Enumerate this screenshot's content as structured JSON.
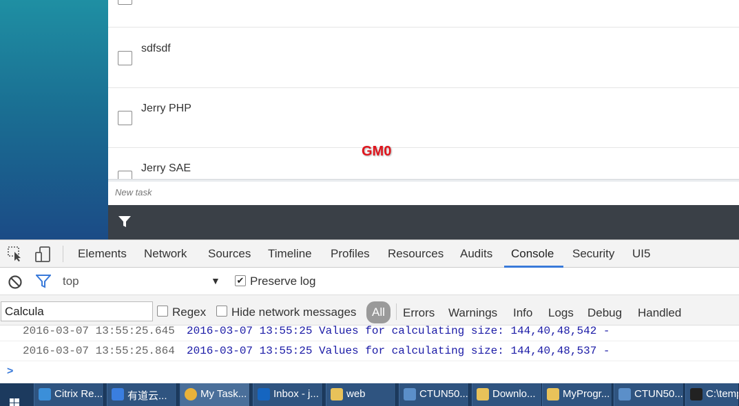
{
  "app": {
    "tasks": [
      {
        "label": ""
      },
      {
        "label": "sdfsdf"
      },
      {
        "label": "Jerry PHP"
      },
      {
        "label": "Jerry SAE"
      }
    ],
    "watermark": "GM0",
    "new_task_placeholder": "New task",
    "colors": {
      "sidebar_top": "#1f8fa3",
      "sidebar_bottom": "#1b4b86",
      "footer": "#3a4047"
    }
  },
  "devtools": {
    "tabs": [
      "Elements",
      "Network",
      "Sources",
      "Timeline",
      "Profiles",
      "Resources",
      "Audits",
      "Console",
      "Security",
      "UI5"
    ],
    "active_tab": "Console",
    "context": "top",
    "preserve_log": {
      "label": "Preserve log",
      "checked": true
    },
    "filter": {
      "value": "Calcula",
      "regex_label": "Regex",
      "hide_network_label": "Hide network messages",
      "all_label": "All",
      "levels": [
        "Errors",
        "Warnings",
        "Info",
        "Logs",
        "Debug",
        "Handled"
      ]
    },
    "logs": [
      {
        "timestamp": "2016-03-07 13:55:25.645",
        "message": "2016-03-07 13:55:25 Values for calculating size: 144,40,48,542 -"
      },
      {
        "timestamp": "2016-03-07 13:55:25.864",
        "message": "2016-03-07 13:55:25 Values for calculating size: 144,40,48,537 -"
      }
    ],
    "prompt": ">"
  },
  "taskbar": {
    "items": [
      {
        "label": "Citrix Re...",
        "icon": "ie-icon"
      },
      {
        "label": "有道云...",
        "icon": "youdao-icon"
      },
      {
        "label": "My Task...",
        "icon": "chrome-icon"
      },
      {
        "label": "Inbox - j...",
        "icon": "outlook-icon"
      },
      {
        "label": "web",
        "icon": "folder-icon"
      },
      {
        "label": "CTUN50...",
        "icon": "remote-desktop-icon"
      },
      {
        "label": "Downlo...",
        "icon": "folder-icon"
      },
      {
        "label": "MyProgr...",
        "icon": "folder-icon"
      },
      {
        "label": "CTUN50...",
        "icon": "remote-desktop-icon"
      },
      {
        "label": "C:\\temp",
        "icon": "cmd-icon"
      }
    ]
  }
}
